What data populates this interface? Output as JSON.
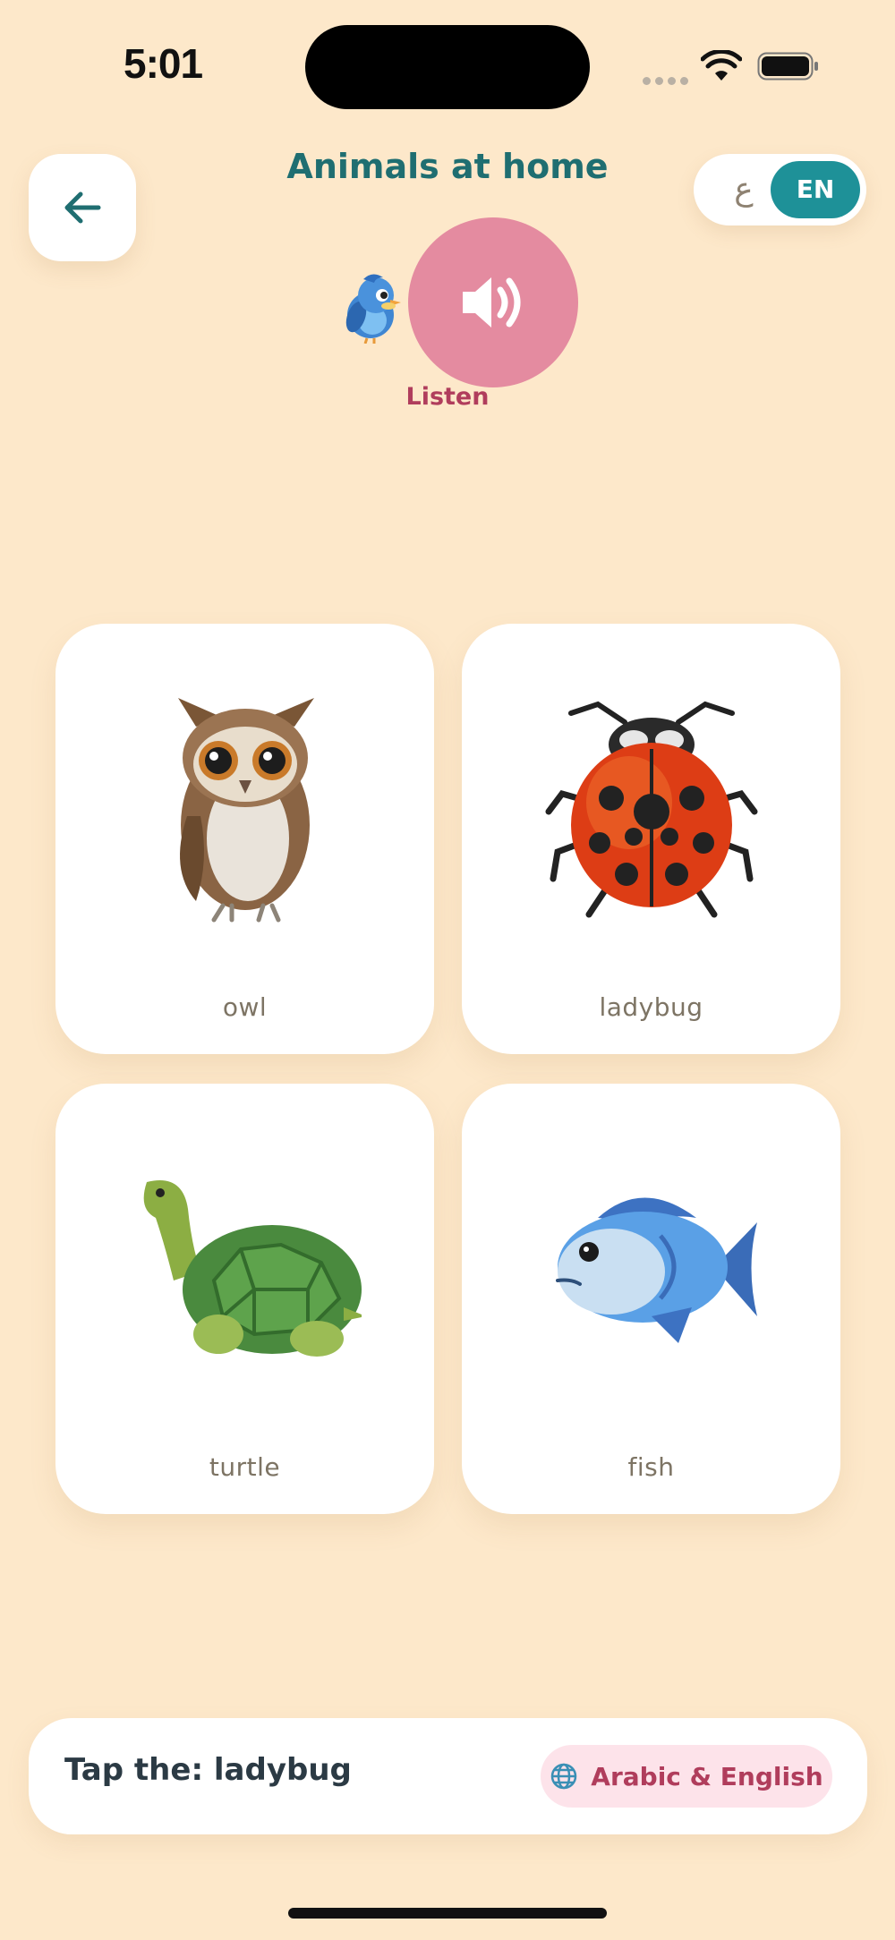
{
  "status_bar": {
    "time": "5:01"
  },
  "header": {
    "title": "Animals at home",
    "back_icon": "arrow-left-icon",
    "language_toggle": {
      "options": [
        "ع",
        "EN"
      ],
      "selected": "EN"
    }
  },
  "listen": {
    "label": "Listen",
    "icon": "speaker-icon",
    "mascot_icon": "bird-mascot-icon"
  },
  "cards": [
    {
      "label": "owl",
      "icon": "owl-icon"
    },
    {
      "label": "ladybug",
      "icon": "ladybug-icon"
    },
    {
      "label": "turtle",
      "icon": "turtle-icon"
    },
    {
      "label": "fish",
      "icon": "fish-icon"
    }
  ],
  "prompt": {
    "text": "Tap the: ladybug",
    "mode_badge": "Arabic & English",
    "mode_icon": "globe-icon"
  },
  "colors": {
    "background": "#fde8ca",
    "title": "#1f6e71",
    "toggle_active": "#1e9198",
    "listen_button": "#e48ba0",
    "accent_text": "#b03d5c",
    "badge_bg": "#fde3ea"
  }
}
